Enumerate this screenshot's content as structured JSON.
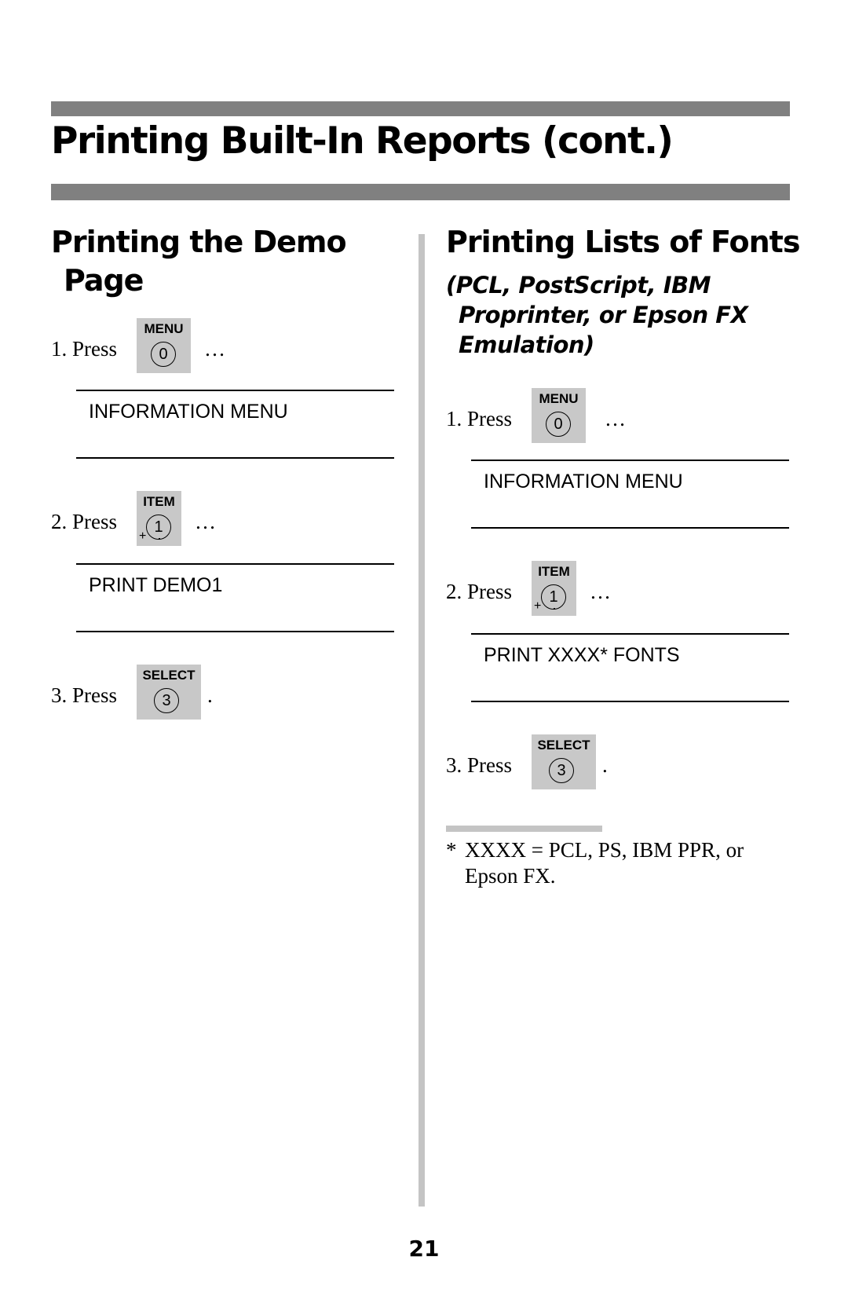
{
  "page": {
    "title": "Printing Built-In Reports (cont.)",
    "page_number": "21"
  },
  "left": {
    "heading_line1": "Printing the Demo",
    "heading_line2": "Page",
    "steps": [
      {
        "label": "1. Press",
        "key_name": "MENU",
        "key_digit": "0",
        "trail": "…"
      },
      {
        "label": "2. Press",
        "key_name": "ITEM",
        "key_digit": "1",
        "trail": "…"
      },
      {
        "label": "3. Press",
        "key_name": "SELECT",
        "key_digit": "3",
        "trail": "."
      }
    ],
    "displays": [
      "INFORMATION MENU",
      "PRINT DEMO1"
    ]
  },
  "right": {
    "heading": "Printing Lists of Fonts",
    "subheading_lines": [
      "(PCL, PostScript, IBM",
      "Proprinter, or Epson FX",
      "Emulation)"
    ],
    "steps": [
      {
        "label": "1. Press",
        "key_name": "MENU",
        "key_digit": "0",
        "trail": "…"
      },
      {
        "label": "2. Press",
        "key_name": "ITEM",
        "key_digit": "1",
        "trail": "…"
      },
      {
        "label": "3. Press",
        "key_name": "SELECT",
        "key_digit": "3",
        "trail": "."
      }
    ],
    "displays": [
      "INFORMATION MENU",
      "PRINT XXXX* FONTS"
    ],
    "footnote": {
      "marker": "*",
      "text": "XXXX = PCL, PS, IBM PPR, or Epson FX."
    }
  },
  "key_symbols": {
    "plus": "+"
  }
}
